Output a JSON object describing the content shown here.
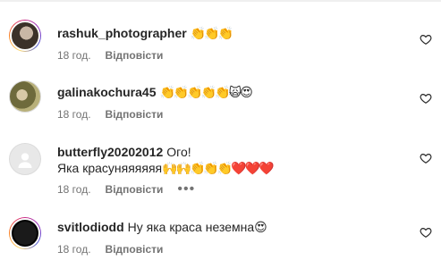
{
  "comments": [
    {
      "username": "rashuk_photographer",
      "text": "",
      "emojis": "👏👏👏",
      "time": "18 год.",
      "reply_label": "Відповісти",
      "avatar_icon": "user-photo-icon",
      "has_story_ring": true
    },
    {
      "username": "galinakochura45",
      "text": "",
      "emojis": "👏👏👏👏👏🙀😍",
      "time": "18 год.",
      "reply_label": "Відповісти",
      "avatar_icon": "user-photo-icon",
      "has_story_ring": false
    },
    {
      "username": "butterfly20202012",
      "text": "Ого!",
      "text_line2": "Яка красуняяяяяя",
      "emojis": "🙌🙌👏👏👏❤️❤️❤️",
      "time": "18 год.",
      "reply_label": "Відповісти",
      "more_label": "•••",
      "avatar_icon": "default-user-icon",
      "has_story_ring": false
    },
    {
      "username": "svitlodiodd",
      "text": "Ну яка краса неземна",
      "emojis": "😍",
      "time": "18 год.",
      "reply_label": "Відповісти",
      "avatar_icon": "user-photo-icon",
      "has_story_ring": true
    }
  ],
  "colors": {
    "primary_text": "#262626",
    "secondary_text": "#737373",
    "heart_outline": "#262626"
  },
  "icons": {
    "like": "heart-outline-icon",
    "more": "more-options-icon"
  }
}
